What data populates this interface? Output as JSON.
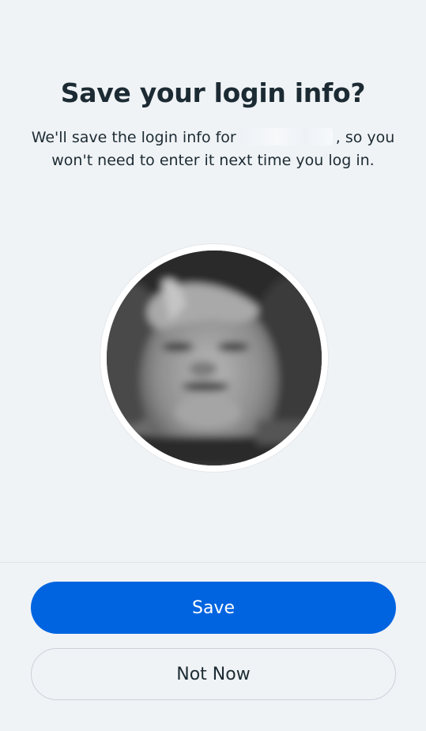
{
  "dialog": {
    "title": "Save your login info?",
    "description_before": "We'll save the login info for",
    "description_after": ", so you won't need to enter it next time you log in."
  },
  "profile": {
    "avatar_icon": "profile-photo"
  },
  "actions": {
    "save_label": "Save",
    "not_now_label": "Not Now"
  },
  "colors": {
    "primary": "#0064e0",
    "background": "#f0f3f6",
    "text": "#1c2b33"
  }
}
